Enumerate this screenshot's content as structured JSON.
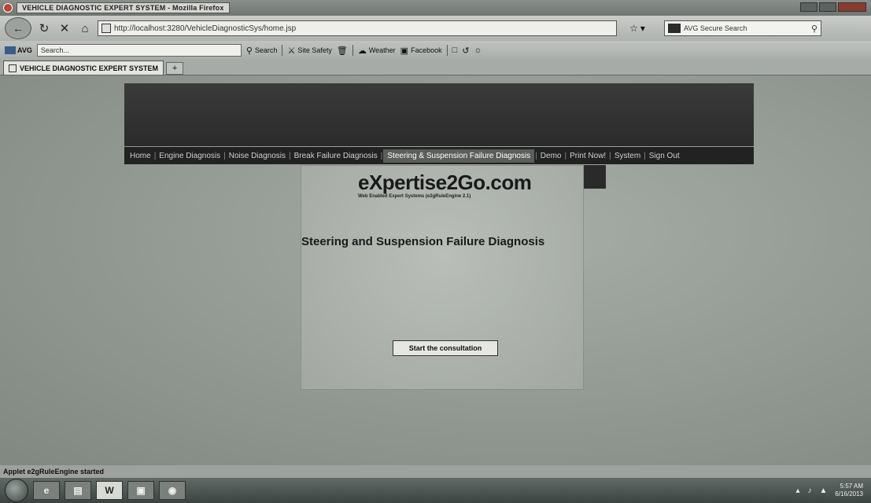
{
  "window": {
    "title": "VEHICLE DIAGNOSTIC EXPERT SYSTEM - Mozilla Firefox"
  },
  "navbar": {
    "url": "http://localhost:3280/VehicleDiagnosticSys/home.jsp",
    "search_engine": "AVG Secure Search"
  },
  "toolbar": {
    "brand": "AVG",
    "search_placeholder": "Search...",
    "search_label": "Search",
    "site_safety": "Site Safety",
    "weather": "Weather",
    "facebook": "Facebook"
  },
  "tabs": [
    {
      "label": "VEHICLE DIAGNOSTIC EXPERT SYSTEM"
    }
  ],
  "menu": {
    "items": [
      "Home",
      "Engine Diagnosis",
      "Noise Diagnosis",
      "Break Failure Diagnosis",
      "Steering & Suspension Failure Diagnosis",
      "Demo",
      "Print Now!",
      "System",
      "Sign Out"
    ],
    "active_index": 4
  },
  "applet": {
    "brand": "eXpertise2Go.com",
    "tagline": "Web Enabled Expert Systems (e2gRuleEngine 2.1)",
    "heading": "Steering and Suspension Failure Diagnosis",
    "start_button": "Start the consultation"
  },
  "status": {
    "text": "Applet e2gRuleEngine started"
  },
  "taskbar": {
    "items": [
      "W"
    ],
    "clock_time": "5:57 AM",
    "clock_date": "6/16/2013"
  }
}
